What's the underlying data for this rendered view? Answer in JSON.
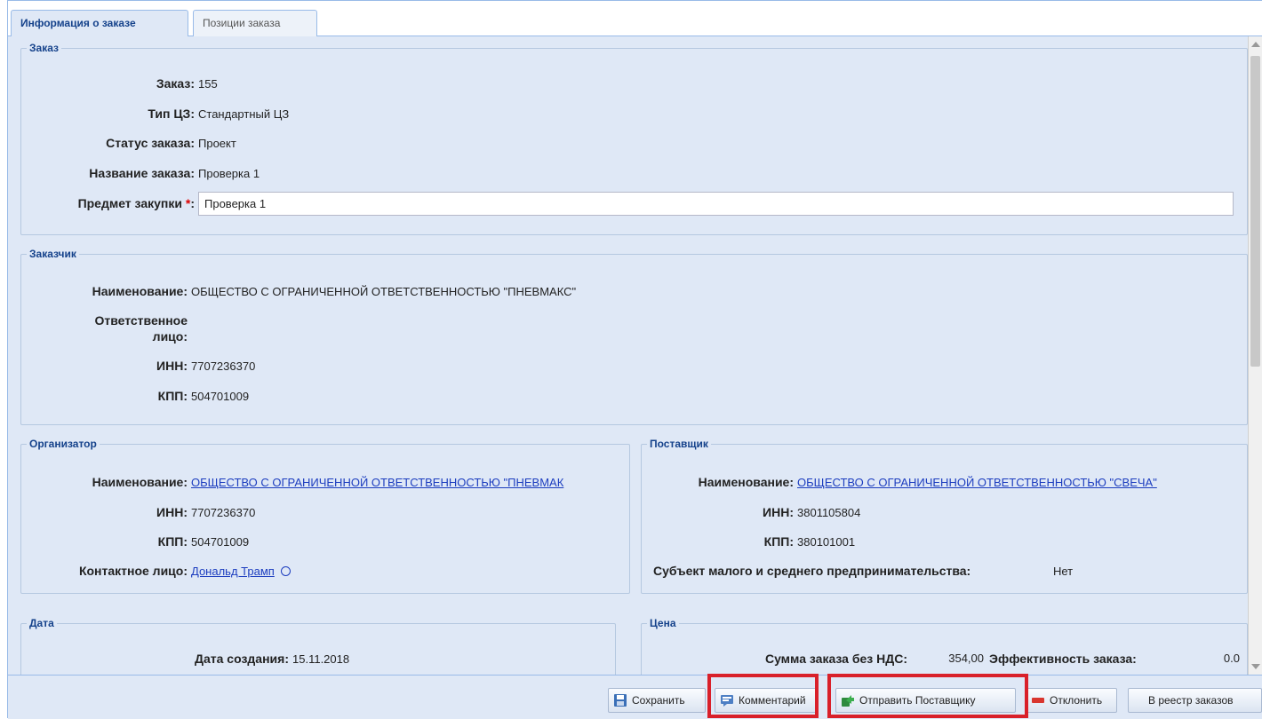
{
  "tabs": [
    {
      "label": "Информация о заказе"
    },
    {
      "label": "Позиции заказа"
    }
  ],
  "order": {
    "legend": "Заказ",
    "order_label": "Заказ:",
    "order_value": "155",
    "type_label": "Тип ЦЗ:",
    "type_value": "Стандартный ЦЗ",
    "status_label": "Статус заказа:",
    "status_value": "Проект",
    "name_label": "Название заказа:",
    "name_value": "Проверка 1",
    "subject_label": "Предмет закупки",
    "subject_required": "*",
    "subject_colon": ":",
    "subject_value": "Проверка 1"
  },
  "customer": {
    "legend": "Заказчик",
    "name_label": "Наименование:",
    "name_value": "ОБЩЕСТВО С ОГРАНИЧЕННОЙ ОТВЕТСТВЕННОСТЬЮ \"ПНЕВМАКС\"",
    "responsible_label_line1": "Ответственное",
    "responsible_label_line2": "лицо:",
    "inn_label": "ИНН:",
    "inn_value": "7707236370",
    "kpp_label": "КПП:",
    "kpp_value": "504701009"
  },
  "organizer": {
    "legend": "Организатор",
    "name_label": "Наименование:",
    "name_value": "ОБЩЕСТВО С ОГРАНИЧЕННОЙ ОТВЕТСТВЕННОСТЬЮ \"ПНЕВМАК",
    "inn_label": "ИНН:",
    "inn_value": "7707236370",
    "kpp_label": "КПП:",
    "kpp_value": "504701009",
    "contact_label": "Контактное лицо:",
    "contact_value": "Дональд Трамп"
  },
  "supplier": {
    "legend": "Поставщик",
    "name_label": "Наименование:",
    "name_value": "ОБЩЕСТВО С ОГРАНИЧЕННОЙ ОТВЕТСТВЕННОСТЬЮ \"СВЕЧА\"",
    "inn_label": "ИНН:",
    "inn_value": "3801105804",
    "kpp_label": "КПП:",
    "kpp_value": "380101001",
    "sme_label": "Субъект малого и среднего предпринимательства:",
    "sme_value": "Нет"
  },
  "date": {
    "legend": "Дата",
    "created_label": "Дата создания:",
    "created_value": "15.11.2018"
  },
  "price": {
    "legend": "Цена",
    "sum_label": "Сумма заказа без НДС:",
    "sum_value": "354,00",
    "efficiency_label": "Эффективность заказа:",
    "efficiency_value": "0.0"
  },
  "footer": {
    "save": "Сохранить",
    "comment": "Комментарий",
    "send": "Отправить Поставщику",
    "reject": "Отклонить",
    "registry": "В реестр заказов"
  },
  "colors": {
    "highlight": "#d9202a",
    "link": "#1c3dbf",
    "panel_bg": "#dfe8f6"
  }
}
